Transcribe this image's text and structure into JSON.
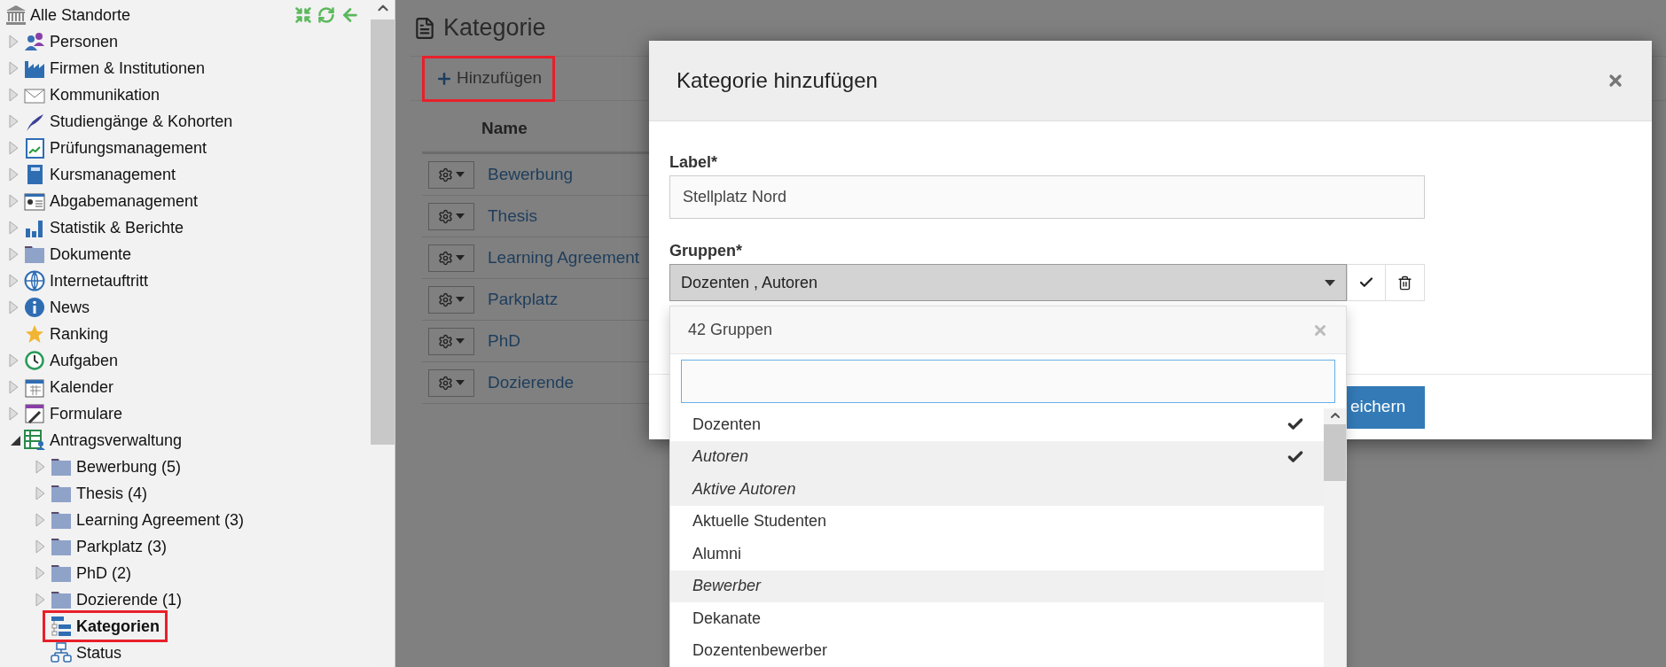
{
  "sidebar": {
    "root": "Alle Standorte",
    "items": [
      {
        "label": "Personen",
        "kind": "branch",
        "expanded": false,
        "selected": false,
        "highlighted": false
      },
      {
        "label": "Firmen & Institutionen",
        "kind": "branch",
        "expanded": false,
        "selected": false,
        "highlighted": false
      },
      {
        "label": "Kommunikation",
        "kind": "branch",
        "expanded": false,
        "selected": false,
        "highlighted": false
      },
      {
        "label": "Studiengänge & Kohorten",
        "kind": "branch",
        "expanded": false,
        "selected": false,
        "highlighted": false
      },
      {
        "label": "Prüfungsmanagement",
        "kind": "branch",
        "expanded": false,
        "selected": false,
        "highlighted": false
      },
      {
        "label": "Kursmanagement",
        "kind": "branch",
        "expanded": false,
        "selected": false,
        "highlighted": false
      },
      {
        "label": "Abgabemanagement",
        "kind": "branch",
        "expanded": false,
        "selected": false,
        "highlighted": false
      },
      {
        "label": "Statistik & Berichte",
        "kind": "branch",
        "expanded": false,
        "selected": false,
        "highlighted": false
      },
      {
        "label": "Dokumente",
        "kind": "branch",
        "expanded": false,
        "selected": false,
        "highlighted": false
      },
      {
        "label": "Internetauftritt",
        "kind": "branch",
        "expanded": false,
        "selected": false,
        "highlighted": false
      },
      {
        "label": "News",
        "kind": "branch",
        "expanded": false,
        "selected": false,
        "highlighted": false
      },
      {
        "label": "Ranking",
        "kind": "leaf",
        "selected": false,
        "highlighted": false
      },
      {
        "label": "Aufgaben",
        "kind": "branch",
        "expanded": false,
        "selected": false,
        "highlighted": false
      },
      {
        "label": "Kalender",
        "kind": "branch",
        "expanded": false,
        "selected": false,
        "highlighted": false
      },
      {
        "label": "Formulare",
        "kind": "branch",
        "expanded": false,
        "selected": false,
        "highlighted": false
      },
      {
        "label": "Antragsverwaltung",
        "kind": "branch",
        "expanded": true,
        "selected": false,
        "highlighted": false,
        "children": [
          {
            "label": "Bewerbung (5)",
            "kind": "branch",
            "expanded": false,
            "selected": false,
            "highlighted": false
          },
          {
            "label": "Thesis (4)",
            "kind": "branch",
            "expanded": false,
            "selected": false,
            "highlighted": false
          },
          {
            "label": "Learning Agreement (3)",
            "kind": "branch",
            "expanded": false,
            "selected": false,
            "highlighted": false
          },
          {
            "label": "Parkplatz (3)",
            "kind": "branch",
            "expanded": false,
            "selected": false,
            "highlighted": false
          },
          {
            "label": "PhD (2)",
            "kind": "branch",
            "expanded": false,
            "selected": false,
            "highlighted": false
          },
          {
            "label": "Dozierende (1)",
            "kind": "branch",
            "expanded": false,
            "selected": false,
            "highlighted": false
          },
          {
            "label": "Kategorien",
            "kind": "leaf",
            "selected": true,
            "highlighted": true
          },
          {
            "label": "Status",
            "kind": "leaf",
            "selected": false,
            "highlighted": false
          }
        ]
      }
    ]
  },
  "page": {
    "title": "Kategorie",
    "add_button": {
      "label": "Hinzufügen",
      "highlighted": true
    },
    "table": {
      "columns": [
        "Name"
      ],
      "rows": [
        "Bewerbung",
        "Thesis",
        "Learning Agreement",
        "Parkplatz",
        "PhD",
        "Dozierende"
      ]
    }
  },
  "modal": {
    "title": "Kategorie hinzufügen",
    "label_field": {
      "label": "Label*",
      "value": "Stellplatz Nord"
    },
    "groups_field": {
      "label": "Gruppen*",
      "value": "Dozenten , Autoren"
    },
    "save_button": "eichern",
    "dropdown": {
      "header": "42 Gruppen",
      "options": [
        {
          "label": "Dozenten",
          "italic": false,
          "checked": true
        },
        {
          "label": "Autoren",
          "italic": true,
          "checked": true
        },
        {
          "label": "Aktive Autoren",
          "italic": true,
          "checked": false
        },
        {
          "label": "Aktuelle Studenten",
          "italic": false,
          "checked": false
        },
        {
          "label": "Alumni",
          "italic": false,
          "checked": false
        },
        {
          "label": "Bewerber",
          "italic": true,
          "checked": false
        },
        {
          "label": "Dekanate",
          "italic": false,
          "checked": false
        },
        {
          "label": "Dozentenbewerber",
          "italic": false,
          "checked": false
        }
      ]
    }
  }
}
